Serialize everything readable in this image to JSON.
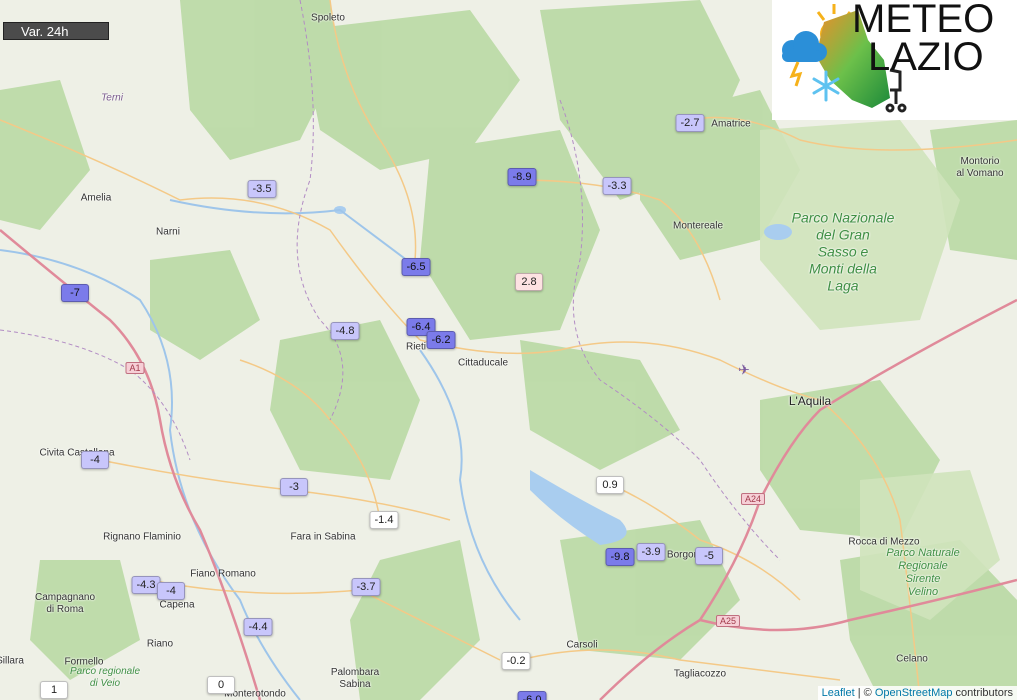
{
  "legend": {
    "label": "Var. 24h"
  },
  "logo": {
    "line1": "METEO",
    "line2": "LAZIO"
  },
  "attribution": {
    "leaflet": "Leaflet",
    "separator": " | © ",
    "osm": "OpenStreetMap",
    "suffix": " contributors"
  },
  "colors": {
    "strong_negative": "#7b7bea",
    "negative": "#c8c6fb",
    "neutral": "#ffffff",
    "positive": "#fde2e2",
    "road": "#f2b35e",
    "highway": "#e08a9a"
  },
  "places": [
    {
      "name": "Spoleto"
    },
    {
      "name": "Terni"
    },
    {
      "name": "Amelia"
    },
    {
      "name": "Narni"
    },
    {
      "name": "Amatrice"
    },
    {
      "name": "Montorio\nal Vomano"
    },
    {
      "name": "Montereale"
    },
    {
      "name": "Rieti"
    },
    {
      "name": "Cittaducale"
    },
    {
      "name": "L'Aquila"
    },
    {
      "name": "Civita Castellana"
    },
    {
      "name": "Rignano Flaminio"
    },
    {
      "name": "Fara in Sabina"
    },
    {
      "name": "Fiano Romano"
    },
    {
      "name": "Campagnano\ndi Roma"
    },
    {
      "name": "Capena"
    },
    {
      "name": "Riano"
    },
    {
      "name": "Formello"
    },
    {
      "name": "Palombara\nSabina"
    },
    {
      "name": "Monterotondo"
    },
    {
      "name": "Carsoli"
    },
    {
      "name": "Tagliacozzo"
    },
    {
      "name": "Rocca di Mezzo"
    },
    {
      "name": "Celano"
    },
    {
      "name": "Borgorose"
    },
    {
      "name": "Parco Nazionale\ndel Gran\nSasso e\nMonti della\nLaga"
    },
    {
      "name": "Parco Naturale\nRegionale\nSirente\nVelino"
    },
    {
      "name": "Parco regionale\ndi Veio"
    },
    {
      "name": "Sillara"
    }
  ],
  "road_shields": [
    "A1",
    "A24",
    "A25"
  ],
  "stations": [
    {
      "value": "-3.5",
      "level": "negative"
    },
    {
      "value": "-8.9",
      "level": "strong_negative"
    },
    {
      "value": "-2.7",
      "level": "negative"
    },
    {
      "value": "-3.3",
      "level": "negative"
    },
    {
      "value": "-6.5",
      "level": "strong_negative"
    },
    {
      "value": "2.8",
      "level": "positive"
    },
    {
      "value": "-7",
      "level": "strong_negative"
    },
    {
      "value": "-4.8",
      "level": "negative"
    },
    {
      "value": "-6.4",
      "level": "strong_negative"
    },
    {
      "value": "-6.2",
      "level": "strong_negative"
    },
    {
      "value": "-4",
      "level": "negative"
    },
    {
      "value": "-3",
      "level": "negative"
    },
    {
      "value": "0.9",
      "level": "neutral"
    },
    {
      "value": "-1.4",
      "level": "neutral"
    },
    {
      "value": "-9.8",
      "level": "strong_negative"
    },
    {
      "value": "-3.9",
      "level": "negative"
    },
    {
      "value": "-5",
      "level": "negative"
    },
    {
      "value": "-4.3",
      "level": "negative"
    },
    {
      "value": "-4",
      "level": "negative"
    },
    {
      "value": "-3.7",
      "level": "negative"
    },
    {
      "value": "-4.4",
      "level": "negative"
    },
    {
      "value": "-0.2",
      "level": "neutral"
    },
    {
      "value": "1",
      "level": "neutral"
    },
    {
      "value": "0",
      "level": "neutral"
    },
    {
      "value": "-6.0",
      "level": "strong_negative"
    }
  ]
}
